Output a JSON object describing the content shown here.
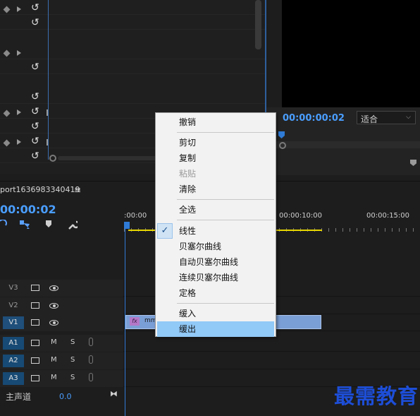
{
  "timeline": {
    "sequence_tab": "port1636983340419",
    "menu_glyph": "≡",
    "timecode": "00:00:02",
    "ruler_labels": [
      ":00:00",
      "00:00:10:00",
      "00:00:15:00"
    ],
    "tracks": [
      {
        "label": "V3"
      },
      {
        "label": "V2"
      },
      {
        "label": "V1"
      },
      {
        "label": "A1",
        "m": "M",
        "s": "S"
      },
      {
        "label": "A2",
        "m": "M",
        "s": "S"
      },
      {
        "label": "A3",
        "m": "M",
        "s": "S"
      }
    ],
    "clip_name": "mm",
    "clip_fx": "fx",
    "master_label": "主声道",
    "master_value": "0.0"
  },
  "monitor": {
    "timecode": "00:00:00:02",
    "fit_label": "适合",
    "chevron": "⌵"
  },
  "effect_controls": {
    "reset_glyph": "↺"
  },
  "context_menu": {
    "items": [
      {
        "label": "撤销",
        "enabled": true
      },
      {
        "label": "剪切",
        "enabled": true
      },
      {
        "label": "复制",
        "enabled": true
      },
      {
        "label": "粘贴",
        "enabled": false
      },
      {
        "label": "清除",
        "enabled": true
      },
      {
        "label": "全选",
        "enabled": true
      },
      {
        "label": "线性",
        "enabled": true,
        "checked": true
      },
      {
        "label": "贝塞尔曲线",
        "enabled": true
      },
      {
        "label": "自动贝塞尔曲线",
        "enabled": true
      },
      {
        "label": "连续贝塞尔曲线",
        "enabled": true
      },
      {
        "label": "定格",
        "enabled": true
      },
      {
        "label": "缓入",
        "enabled": true
      },
      {
        "label": "缓出",
        "enabled": true,
        "highlighted": true
      }
    ],
    "check_glyph": "✓"
  },
  "watermark": {
    "text": "最需教育"
  },
  "colors": {
    "accent": "#2f7bd6",
    "timecode": "#4a9eff",
    "menu_highlight": "#91c9f7",
    "inout_bar": "#e8d600",
    "clip": "#7a9fd6"
  }
}
